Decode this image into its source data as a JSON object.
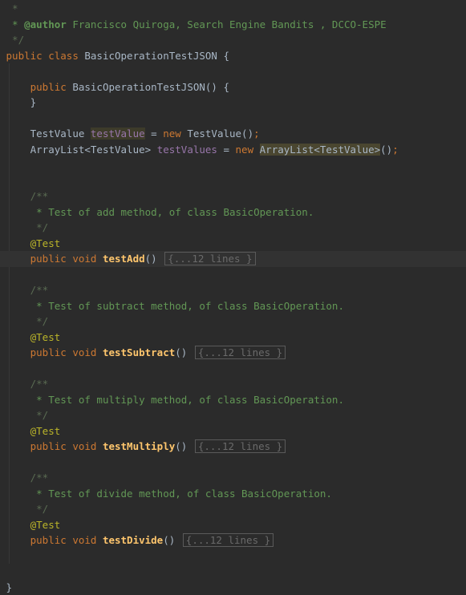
{
  "code": {
    "lines": [
      {
        "segments": [
          {
            "text": " *",
            "cls": "cmt-dim"
          }
        ]
      },
      {
        "segments": [
          {
            "text": " * ",
            "cls": "cmt"
          },
          {
            "text": "@author",
            "cls": "cmt-tag"
          },
          {
            "text": " Francisco Quiroga, Search Engine Bandits , DCCO-ESPE",
            "cls": "cmt"
          }
        ]
      },
      {
        "segments": [
          {
            "text": " */",
            "cls": "cmt-dim"
          }
        ]
      },
      {
        "segments": [
          {
            "text": "public class ",
            "cls": "kw"
          },
          {
            "text": "BasicOperationTestJSON {",
            "cls": ""
          }
        ]
      },
      {
        "segments": []
      },
      {
        "segments": [
          {
            "text": "    public ",
            "cls": "kw"
          },
          {
            "text": "BasicOperationTestJSON() {",
            "cls": ""
          }
        ]
      },
      {
        "segments": [
          {
            "text": "    }",
            "cls": ""
          }
        ]
      },
      {
        "segments": []
      },
      {
        "segments": [
          {
            "text": "    TestValue ",
            "cls": ""
          },
          {
            "text": "testValue",
            "cls": "hl-field"
          },
          {
            "text": " = ",
            "cls": ""
          },
          {
            "text": "new ",
            "cls": "kw"
          },
          {
            "text": "TestValue()",
            "cls": ""
          },
          {
            "text": ";",
            "cls": "kw"
          }
        ]
      },
      {
        "segments": [
          {
            "text": "    ArrayList<TestValue> ",
            "cls": ""
          },
          {
            "text": "testValues",
            "cls": "field"
          },
          {
            "text": " = ",
            "cls": ""
          },
          {
            "text": "new ",
            "cls": "kw"
          },
          {
            "text": "ArrayList<TestValue>",
            "cls": "hl-type"
          },
          {
            "text": "()",
            "cls": ""
          },
          {
            "text": ";",
            "cls": "kw"
          }
        ]
      },
      {
        "segments": []
      },
      {
        "segments": []
      },
      {
        "segments": [
          {
            "text": "    /**",
            "cls": "cmt-dim"
          }
        ]
      },
      {
        "segments": [
          {
            "text": "     * Test of add method, of class BasicOperation.",
            "cls": "cmt"
          }
        ]
      },
      {
        "segments": [
          {
            "text": "     */",
            "cls": "cmt-dim"
          }
        ]
      },
      {
        "segments": [
          {
            "text": "    @Test",
            "cls": "ann"
          }
        ]
      },
      {
        "segments": [
          {
            "text": "    public void ",
            "cls": "kw"
          },
          {
            "text": "testAdd",
            "cls": "fn"
          },
          {
            "text": "() ",
            "cls": ""
          },
          {
            "fold": "{...12 lines }"
          }
        ],
        "highlight": true
      },
      {
        "segments": []
      },
      {
        "segments": [
          {
            "text": "    /**",
            "cls": "cmt-dim"
          }
        ]
      },
      {
        "segments": [
          {
            "text": "     * Test of subtract method, of class BasicOperation.",
            "cls": "cmt"
          }
        ]
      },
      {
        "segments": [
          {
            "text": "     */",
            "cls": "cmt-dim"
          }
        ]
      },
      {
        "segments": [
          {
            "text": "    @Test",
            "cls": "ann"
          }
        ]
      },
      {
        "segments": [
          {
            "text": "    public void ",
            "cls": "kw"
          },
          {
            "text": "testSubtract",
            "cls": "fn"
          },
          {
            "text": "() ",
            "cls": ""
          },
          {
            "fold": "{...12 lines }"
          }
        ]
      },
      {
        "segments": []
      },
      {
        "segments": [
          {
            "text": "    /**",
            "cls": "cmt-dim"
          }
        ]
      },
      {
        "segments": [
          {
            "text": "     * Test of multiply method, of class BasicOperation.",
            "cls": "cmt"
          }
        ]
      },
      {
        "segments": [
          {
            "text": "     */",
            "cls": "cmt-dim"
          }
        ]
      },
      {
        "segments": [
          {
            "text": "    @Test",
            "cls": "ann"
          }
        ]
      },
      {
        "segments": [
          {
            "text": "    public void ",
            "cls": "kw"
          },
          {
            "text": "testMultiply",
            "cls": "fn"
          },
          {
            "text": "() ",
            "cls": ""
          },
          {
            "fold": "{...12 lines }"
          }
        ]
      },
      {
        "segments": []
      },
      {
        "segments": [
          {
            "text": "    /**",
            "cls": "cmt-dim"
          }
        ]
      },
      {
        "segments": [
          {
            "text": "     * Test of divide method, of class BasicOperation.",
            "cls": "cmt"
          }
        ]
      },
      {
        "segments": [
          {
            "text": "     */",
            "cls": "cmt-dim"
          }
        ]
      },
      {
        "segments": [
          {
            "text": "    @Test",
            "cls": "ann"
          }
        ]
      },
      {
        "segments": [
          {
            "text": "    public void ",
            "cls": "kw"
          },
          {
            "text": "testDivide",
            "cls": "fn"
          },
          {
            "text": "() ",
            "cls": ""
          },
          {
            "fold": "{...12 lines }"
          }
        ]
      },
      {
        "segments": []
      },
      {
        "segments": []
      },
      {
        "segments": [
          {
            "text": "}",
            "cls": ""
          }
        ]
      }
    ]
  },
  "colors": {
    "background": "#2b2b2b",
    "keyword": "#cc7832",
    "method": "#ffc66d",
    "annotation": "#bbb529",
    "comment": "#629755",
    "field": "#9876aa",
    "text": "#a9b7c6"
  }
}
